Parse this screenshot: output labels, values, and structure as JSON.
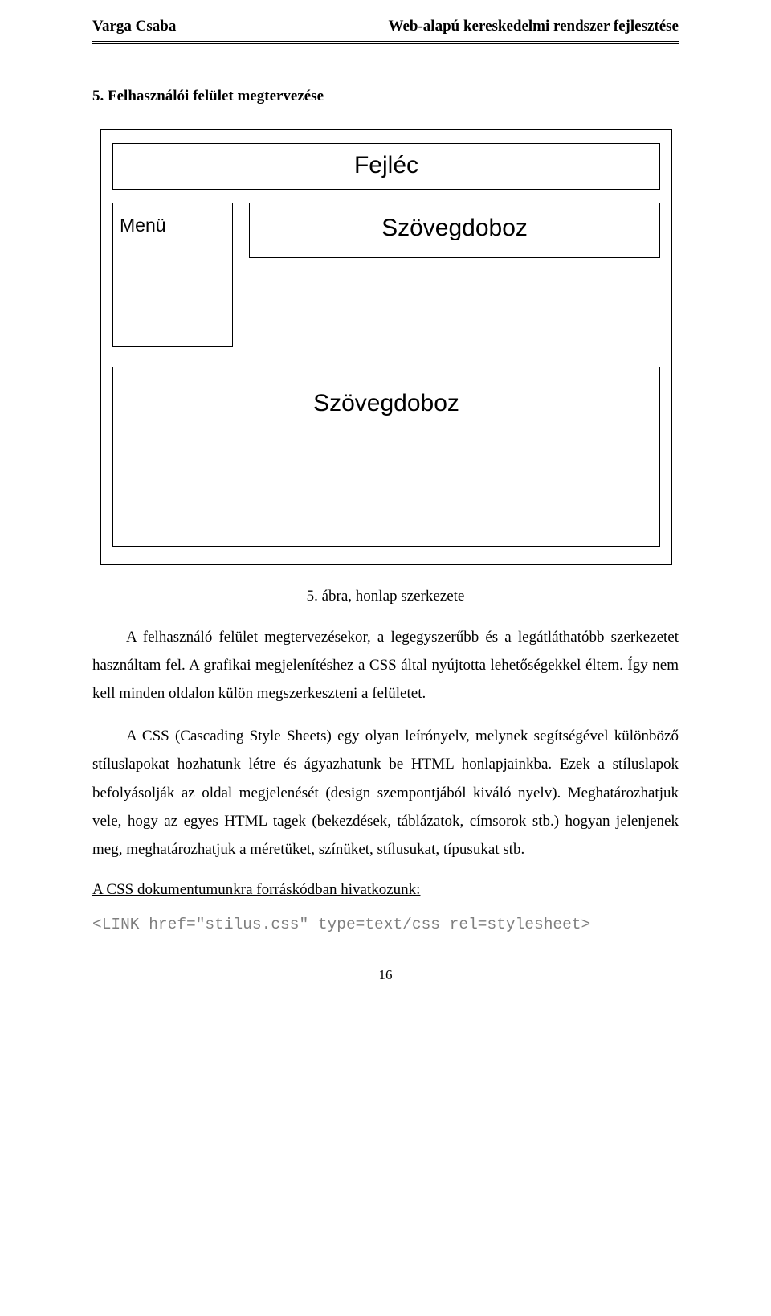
{
  "header": {
    "left": "Varga Csaba",
    "right": "Web-alapú kereskedelmi rendszer fejlesztése"
  },
  "section_title": "5. Felhasználói felület megtervezése",
  "wireframe": {
    "header": "Fejléc",
    "menu": "Menü",
    "textbox_top": "Szövegdoboz",
    "textbox_big": "Szövegdoboz"
  },
  "caption": "5. ábra, honlap szerkezete",
  "paragraphs": {
    "p1": "A felhasználó felület megtervezésekor, a legegyszerűbb és a legátláthatóbb szerkezetet használtam fel. A grafikai megjelenítéshez a CSS által nyújtotta lehetőségekkel éltem. Így nem kell minden oldalon külön megszerkeszteni a felületet.",
    "p2": "A CSS (Cascading Style Sheets) egy olyan leírónyelv, melynek segítségével különböző stíluslapokat hozhatunk létre és ágyazhatunk be HTML honlapjainkba. Ezek a stíluslapok befolyásolják az oldal megjelenését (design szempontjából kiváló nyelv). Meghatározhatjuk vele, hogy az egyes HTML tagek (bekezdések, táblázatok, címsorok stb.) hogyan jelenjenek meg, meghatározhatjuk a méretüket, színüket, stílusukat, típusukat stb."
  },
  "link_line": "A CSS dokumentumunkra forráskódban hivatkozunk:",
  "code_line": "<LINK href=\"stilus.css\" type=text/css rel=stylesheet>",
  "page_number": "16"
}
